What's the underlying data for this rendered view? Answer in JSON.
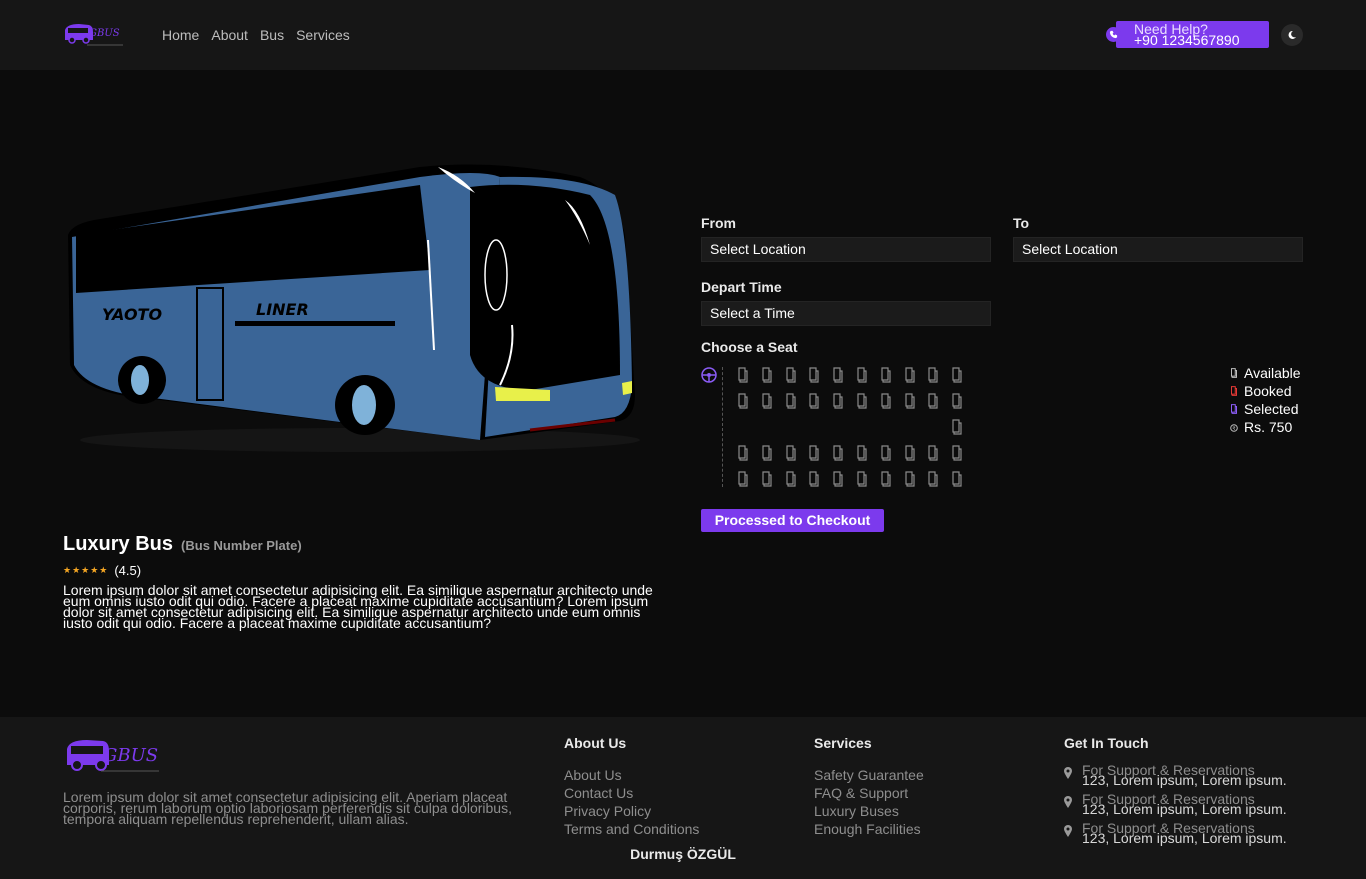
{
  "header": {
    "logo_text": "GBUS",
    "nav": [
      "Home",
      "About",
      "Bus",
      "Services"
    ],
    "help_label": "Need Help?",
    "help_phone": "+90 1234567890"
  },
  "bus": {
    "side_text_left": "YAOTO",
    "side_text_right": "LINER",
    "name": "Luxury Bus",
    "plate": "(Bus Number Plate)",
    "stars": "★★★★★",
    "rating": "(4.5)",
    "description": "Lorem ipsum dolor sit amet consectetur adipisicing elit. Ea similique aspernatur architecto unde eum omnis iusto odit qui odio. Facere a placeat maxime cupiditate accusantium? Lorem ipsum dolor sit amet consectetur adipisicing elit. Ea similique aspernatur architecto unde eum omnis iusto odit qui odio. Facere a placeat maxime cupiditate accusantium?"
  },
  "booking": {
    "from_label": "From",
    "from_value": "Select Location",
    "to_label": "To",
    "to_value": "Select Location",
    "depart_label": "Depart Time",
    "depart_value": "Select a Time",
    "seat_label": "Choose a Seat",
    "checkout_label": "Processed to Checkout",
    "seat_rows": [
      {
        "count": 10,
        "status": "available"
      },
      {
        "count": 10,
        "status": "available"
      },
      {
        "count": 1,
        "status": "available"
      },
      {
        "count": 10,
        "status": "available"
      },
      {
        "count": 10,
        "status": "available"
      }
    ],
    "legend": [
      {
        "label": "Available",
        "color": "#bdbdbd"
      },
      {
        "label": "Booked",
        "color": "#e53935"
      },
      {
        "label": "Selected",
        "color": "#8b5cf6"
      },
      {
        "label": "Rs. 750",
        "color": "#bdbdbd"
      }
    ]
  },
  "footer": {
    "description": "Lorem ipsum dolor sit amet consectetur adipisicing elit. Aperiam placeat corporis, rerum laborum optio laboriosam perferendis sit culpa doloribus, tempora aliquam repellendus reprehenderit, ullam alias.",
    "about": {
      "title": "About Us",
      "links": [
        "About Us",
        "Contact Us",
        "Privacy Policy",
        "Terms and Conditions"
      ]
    },
    "services": {
      "title": "Services",
      "links": [
        "Safety Guarantee",
        "FAQ & Support",
        "Luxury Buses",
        "Enough Facilities"
      ]
    },
    "contact": {
      "title": "Get In Touch",
      "items": [
        {
          "label": "For Support & Reservations",
          "value": "123, Lorem ipsum, Lorem ipsum."
        },
        {
          "label": "For Support & Reservations",
          "value": "123, Lorem ipsum, Lorem ipsum."
        },
        {
          "label": "For Support & Reservations",
          "value": "123, Lorem ipsum, Lorem ipsum."
        }
      ]
    },
    "author": "Durmuş ÖZGÜL"
  },
  "colors": {
    "accent": "#7c3aed",
    "background": "#0c0c0c",
    "panel": "#161616"
  }
}
